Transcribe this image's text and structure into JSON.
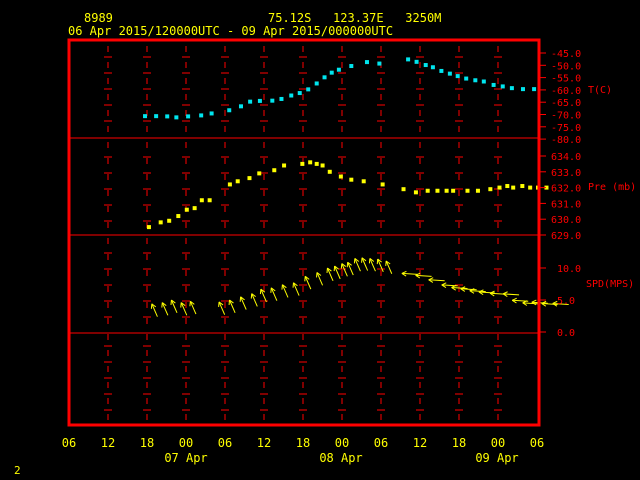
{
  "header": {
    "station_id": "8989",
    "location": "75.12S   123.37E   3250M",
    "date_range": "06 Apr 2015/120000UTC - 09 Apr 2015/000000UTC"
  },
  "footer": {
    "page_number": "2"
  },
  "colors": {
    "background": "#000000",
    "frame": "#ff0000",
    "axis_text": "#ffff00",
    "temperature": "#00e5ee",
    "pressure": "#ffff00",
    "wind": "#ffff00"
  },
  "chart_data": [
    {
      "type": "scatter",
      "ylabel": "T(C)",
      "ylim": [
        -80,
        -45
      ],
      "y_ticks": [
        "-45.0",
        "-50.0",
        "-55.0",
        "-60.0",
        "-65.0",
        "-70.0",
        "-75.0",
        "-80.0"
      ],
      "x_ticks": [
        "06",
        "12",
        "18",
        "00",
        "06",
        "12",
        "18",
        "00",
        "06",
        "12",
        "18",
        "00",
        "06"
      ],
      "x_day_labels": [
        "07 Apr",
        "08 Apr",
        "09 Apr"
      ],
      "xlim_hours": [
        0,
        72
      ],
      "x_hours": [
        11.8,
        13.5,
        15.2,
        16.6,
        18.4,
        20.4,
        22.0,
        24.7,
        26.5,
        27.9,
        29.4,
        31.3,
        32.7,
        34.2,
        35.5,
        36.8,
        38.1,
        39.3,
        40.4,
        41.5,
        43.4,
        45.8,
        47.7,
        52.1,
        53.4,
        54.8,
        55.9,
        57.2,
        58.5,
        59.7,
        61.0,
        62.4,
        63.7,
        65.2,
        66.6,
        68.0,
        69.7,
        71.4
      ],
      "values": [
        -70.7,
        -70.7,
        -70.8,
        -71.2,
        -70.8,
        -70.4,
        -69.6,
        -68.3,
        -66.7,
        -64.8,
        -64.5,
        -64.4,
        -63.7,
        -62.3,
        -61.3,
        -59.8,
        -57.4,
        -54.9,
        -53.0,
        -51.8,
        -50.3,
        -48.7,
        -49.3,
        -47.6,
        -48.6,
        -49.9,
        -50.8,
        -52.3,
        -53.4,
        -54.4,
        -55.4,
        -56.1,
        -56.6,
        -58.0,
        -58.6,
        -59.3,
        -59.7,
        -59.7
      ]
    },
    {
      "type": "scatter",
      "ylabel": "Pre (mb)",
      "ylim": [
        629,
        634
      ],
      "y_ticks": [
        "634.0",
        "633.0",
        "632.0",
        "631.0",
        "630.0",
        "629.0"
      ],
      "xlim_hours": [
        0,
        72
      ],
      "x_hours": [
        12.4,
        14.2,
        15.5,
        16.9,
        18.2,
        19.4,
        20.5,
        21.7,
        24.8,
        26.0,
        27.8,
        29.3,
        31.6,
        33.1,
        35.9,
        37.1,
        38.1,
        39.0,
        40.1,
        41.8,
        43.4,
        45.3,
        48.2,
        51.4,
        53.3,
        55.1,
        56.6,
        58.0,
        59.0,
        61.2,
        62.8,
        64.7,
        66.1,
        67.3,
        68.2,
        69.6,
        70.8,
        72.0,
        73.3
      ],
      "values": [
        629.5,
        629.8,
        629.9,
        630.2,
        630.6,
        630.7,
        631.2,
        631.2,
        632.2,
        632.4,
        632.6,
        632.9,
        633.1,
        633.4,
        633.5,
        633.6,
        633.5,
        633.4,
        633.0,
        632.7,
        632.5,
        632.4,
        632.2,
        631.9,
        631.7,
        631.8,
        631.8,
        631.8,
        631.8,
        631.8,
        631.8,
        631.9,
        632.0,
        632.1,
        632.0,
        632.1,
        632.0,
        632.0,
        632.0
      ]
    },
    {
      "type": "scatter",
      "ylabel": "SPD(MPS)",
      "ylim": [
        0,
        13
      ],
      "y_ticks": [
        "10.0",
        "5.0",
        "0.0"
      ],
      "xlim_hours": [
        0,
        72
      ],
      "x_hours": [
        13.7,
        15.3,
        16.7,
        18.2,
        19.6,
        24.0,
        25.6,
        27.3,
        29.0,
        30.4,
        32.0,
        33.7,
        35.4,
        37.2,
        39.0,
        40.6,
        41.7,
        42.8,
        43.7,
        44.8,
        45.9,
        47.1,
        48.3,
        49.6,
        53.6,
        55.7,
        57.7,
        59.7,
        61.2,
        62.6,
        64.0,
        65.4,
        67.1,
        69.1,
        70.5,
        72.1,
        73.5,
        75.0,
        76.7
      ],
      "values": [
        2.4,
        2.6,
        3.0,
        2.6,
        2.8,
        2.7,
        3.0,
        3.5,
        4.0,
        4.7,
        4.9,
        5.4,
        5.7,
        6.7,
        7.3,
        8.0,
        8.3,
        8.7,
        8.9,
        9.5,
        9.6,
        9.5,
        9.4,
        9.1,
        9.0,
        8.7,
        8.0,
        7.2,
        6.8,
        6.6,
        6.3,
        6.1,
        5.9,
        5.8,
        4.8,
        4.4,
        4.5,
        4.3,
        4.3
      ],
      "direction_deg": [
        200,
        200,
        200,
        200,
        200,
        200,
        200,
        200,
        200,
        200,
        200,
        200,
        200,
        200,
        200,
        210,
        210,
        210,
        210,
        210,
        210,
        210,
        210,
        210,
        90,
        90,
        90,
        90,
        90,
        90,
        90,
        90,
        90,
        90,
        90,
        90,
        90,
        90,
        80
      ]
    }
  ]
}
